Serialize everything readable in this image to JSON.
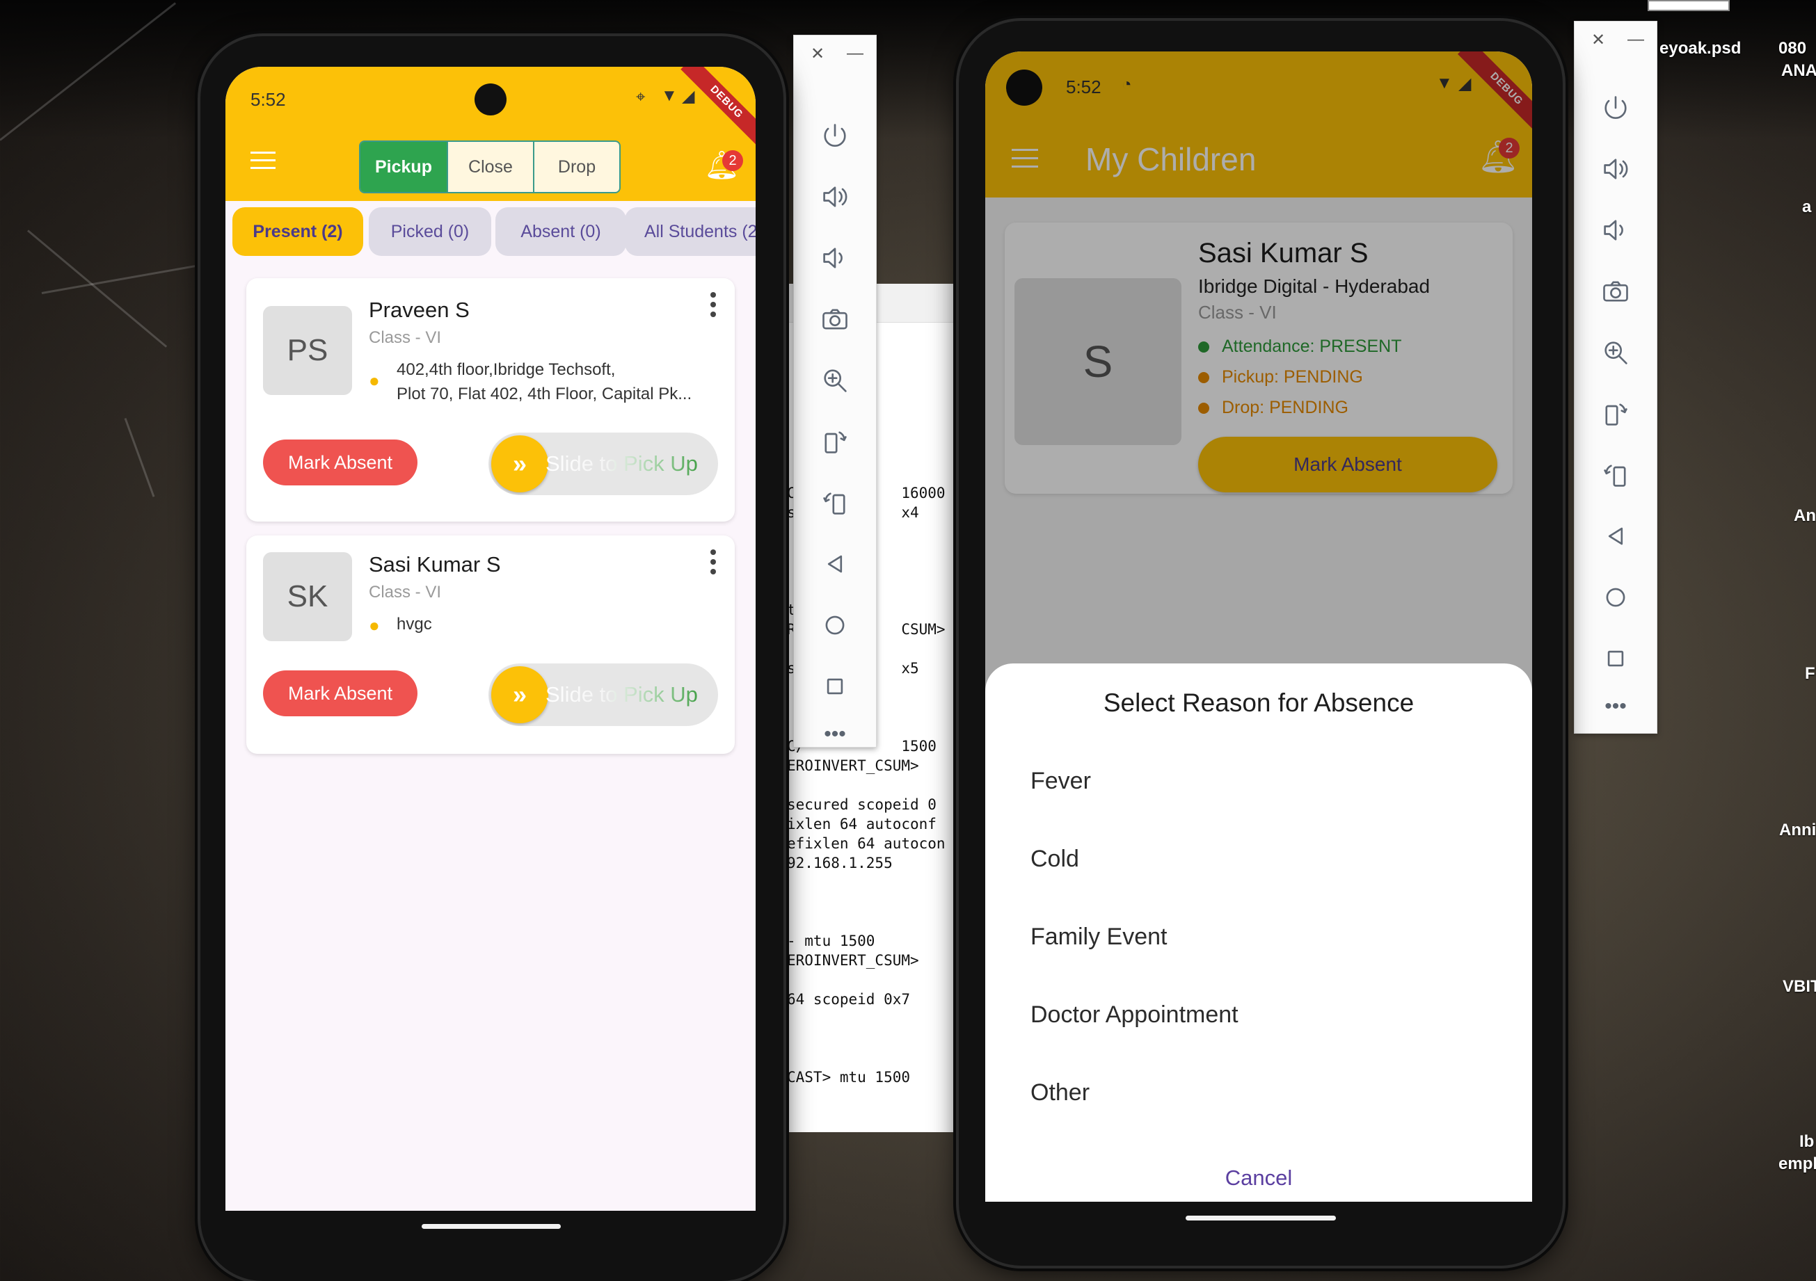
{
  "desktop": {
    "psd_label": "eyoak.psd",
    "labels": [
      "080",
      "ANA",
      "a",
      "An",
      "F",
      "Anni",
      "VBIT",
      "Ib",
      "empl"
    ]
  },
  "terminal": {
    "lines": [
      "C/           16000",
      "s            x4",
      "",
      "",
      "",
      "",
      "t",
      "R            CSUM>",
      "",
      "s            x5",
      "",
      "",
      "",
      "C/           1500",
      "EROINVERT_CSUM>",
      "",
      "secured scopeid 0",
      "ixlen 64 autoconf",
      "efixlen 64 autocon",
      "92.168.1.255",
      "",
      "",
      "",
      "- mtu 1500",
      "EROINVERT_CSUM>",
      "",
      "64 scopeid 0x7",
      "",
      "",
      "",
      "CAST> mtu 1500"
    ]
  },
  "left_phone": {
    "status_time": "5:52",
    "debug": "DEBUG",
    "segments": [
      "Pickup",
      "Close",
      "Drop"
    ],
    "notification_count": "2",
    "chips": [
      "Present (2)",
      "Picked (0)",
      "Absent (0)",
      "All Students (2)"
    ],
    "students": [
      {
        "initials": "PS",
        "name": "Praveen S",
        "class": "Class - VI",
        "address_line1": "402,4th floor,Ibridge Techsoft,",
        "address_line2": "Plot 70, Flat 402, 4th Floor, Capital Pk...",
        "mark_absent": "Mark Absent",
        "slide": "Slide to Pick Up"
      },
      {
        "initials": "SK",
        "name": "Sasi Kumar S",
        "class": "Class - VI",
        "address_line1": "hvgc",
        "address_line2": "",
        "mark_absent": "Mark Absent",
        "slide": "Slide to Pick Up"
      }
    ]
  },
  "right_phone": {
    "status_time": "5:52",
    "debug": "DEBUG",
    "title": "My Children",
    "notification_count": "2",
    "child": {
      "initial": "S",
      "name": "Sasi Kumar S",
      "school": "Ibridge Digital - Hyderabad",
      "class": "Class - VI",
      "attendance": "Attendance: PRESENT",
      "pickup": "Pickup: PENDING",
      "drop": "Drop: PENDING",
      "mark_absent": "Mark Absent"
    },
    "dialog": {
      "title": "Select Reason for Absence",
      "reasons": [
        "Fever",
        "Cold",
        "Family Event",
        "Doctor Appointment",
        "Other"
      ],
      "cancel": "Cancel"
    }
  },
  "colors": {
    "accent_yellow": "#fcc108",
    "green": "#2ea44f",
    "red": "#ef5350",
    "purple": "#5b3fa0"
  }
}
